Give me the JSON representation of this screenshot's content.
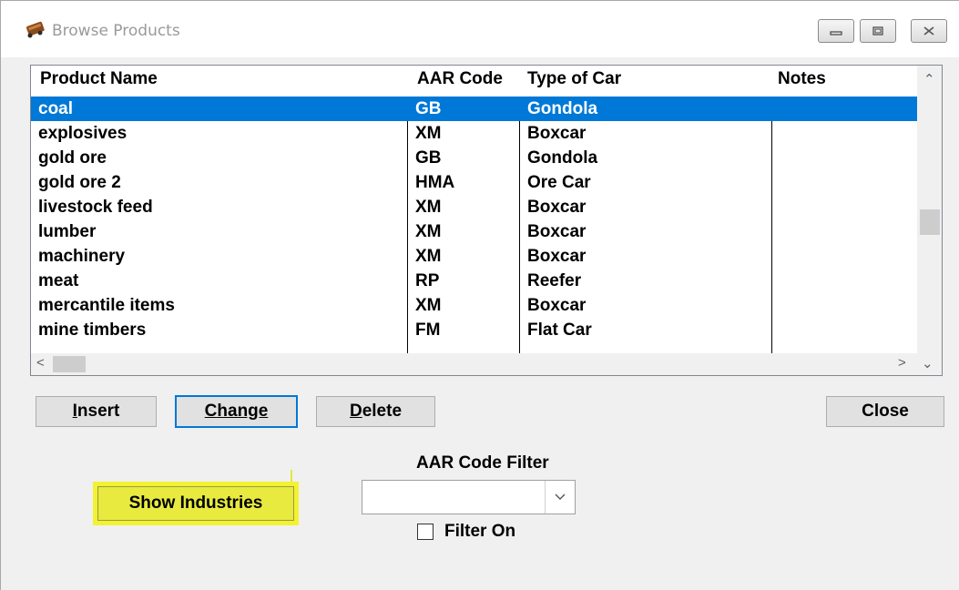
{
  "window": {
    "title": "Browse Products",
    "icon": "railcar-icon"
  },
  "table": {
    "columns": [
      "Product Name",
      "AAR Code",
      "Type of Car",
      "Notes"
    ],
    "rows": [
      {
        "name": "coal",
        "aar": "GB",
        "car": "Gondola",
        "notes": "",
        "selected": true
      },
      {
        "name": "explosives",
        "aar": "XM",
        "car": "Boxcar",
        "notes": ""
      },
      {
        "name": "gold ore",
        "aar": "GB",
        "car": "Gondola",
        "notes": ""
      },
      {
        "name": "gold ore 2",
        "aar": "HMA",
        "car": "Ore Car",
        "notes": ""
      },
      {
        "name": "livestock feed",
        "aar": "XM",
        "car": "Boxcar",
        "notes": ""
      },
      {
        "name": "lumber",
        "aar": "XM",
        "car": "Boxcar",
        "notes": ""
      },
      {
        "name": "machinery",
        "aar": "XM",
        "car": "Boxcar",
        "notes": ""
      },
      {
        "name": "meat",
        "aar": "RP",
        "car": "Reefer",
        "notes": ""
      },
      {
        "name": "mercantile items",
        "aar": "XM",
        "car": "Boxcar",
        "notes": ""
      },
      {
        "name": "mine timbers",
        "aar": "FM",
        "car": "Flat Car",
        "notes": ""
      }
    ]
  },
  "buttons": {
    "insert_rest": "nsert",
    "insert_key": "I",
    "change_key": "C",
    "change_rest": "hange",
    "delete_key": "D",
    "delete_rest": "elete",
    "close": "Close",
    "show_industries": "Show Industries"
  },
  "filter": {
    "label": "AAR Code Filter",
    "value": "",
    "checkbox_label": "Filter On",
    "checked": false
  },
  "colors": {
    "selection": "#0078d7",
    "highlight": "#f2f233"
  }
}
